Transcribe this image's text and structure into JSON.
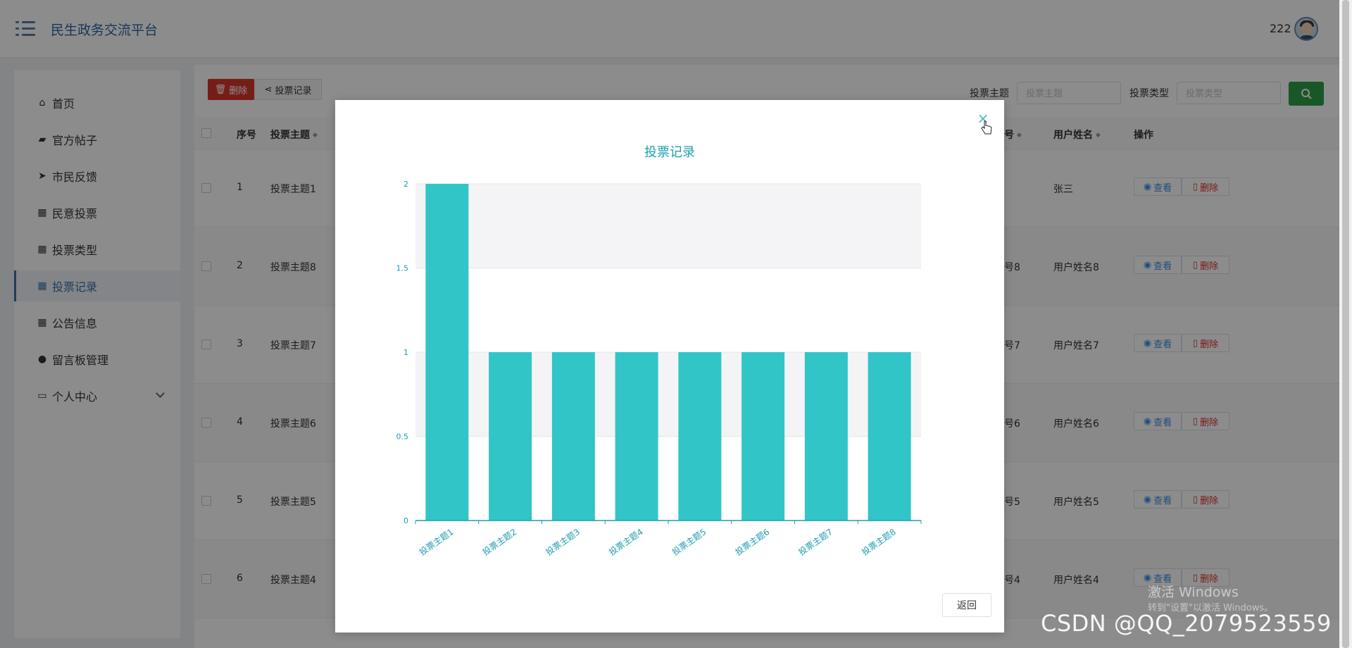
{
  "header": {
    "brand": "民生政务交流平台",
    "username": "222"
  },
  "sidebar": {
    "items": [
      {
        "label": "首页",
        "icon": "home-icon",
        "glyph": "⌂"
      },
      {
        "label": "官方帖子",
        "icon": "wallet-icon",
        "glyph": "▰"
      },
      {
        "label": "市民反馈",
        "icon": "paper-plane-icon",
        "glyph": "➤"
      },
      {
        "label": "民意投票",
        "icon": "grid-icon",
        "glyph": "▦"
      },
      {
        "label": "投票类型",
        "icon": "apps-icon",
        "glyph": "▦"
      },
      {
        "label": "投票记录",
        "icon": "grid-icon",
        "glyph": "▦"
      },
      {
        "label": "公告信息",
        "icon": "grid-icon",
        "glyph": "▦"
      },
      {
        "label": "留言板管理",
        "icon": "user-icon",
        "glyph": "●"
      },
      {
        "label": "个人中心",
        "icon": "id-card-icon",
        "glyph": "▭"
      }
    ]
  },
  "toolbar": {
    "delete_label": "删除",
    "record_label": "投票记录",
    "topic_label": "投票主题",
    "topic_placeholder": "投票主题",
    "type_label": "投票类型",
    "type_placeholder": "投票类型"
  },
  "table": {
    "headers": {
      "index": "序号",
      "topic": "投票主题",
      "account_tail": "号",
      "username": "用户姓名",
      "action": "操作"
    },
    "rows": [
      {
        "index": "1",
        "topic": "投票主题1",
        "account_tail": "",
        "username": "张三"
      },
      {
        "index": "2",
        "topic": "投票主题8",
        "account_tail": "号8",
        "username": "用户姓名8"
      },
      {
        "index": "3",
        "topic": "投票主题7",
        "account_tail": "号7",
        "username": "用户姓名7"
      },
      {
        "index": "4",
        "topic": "投票主题6",
        "account_tail": "号6",
        "username": "用户姓名6"
      },
      {
        "index": "5",
        "topic": "投票主题5",
        "account_tail": "号5",
        "username": "用户姓名5"
      },
      {
        "index": "6",
        "topic": "投票主题4",
        "account_tail": "号4",
        "username": "用户姓名4"
      }
    ],
    "view_label": "查看",
    "delete_label": "删除"
  },
  "modal": {
    "return_label": "返回",
    "close_glyph": "×"
  },
  "chart_data": {
    "type": "bar",
    "title": "投票记录",
    "categories": [
      "投票主题1",
      "投票主题2",
      "投票主题3",
      "投票主题4",
      "投票主题5",
      "投票主题6",
      "投票主题7",
      "投票主题8"
    ],
    "values": [
      2,
      1,
      1,
      1,
      1,
      1,
      1,
      1
    ],
    "yticks": [
      "0",
      "0.5",
      "1",
      "1.5",
      "2"
    ],
    "ylim": [
      0,
      2
    ],
    "xlabel": "",
    "ylabel": "",
    "grid": true,
    "bar_color": "#32c5c8",
    "axis_color": "#1e9eae"
  },
  "watermarks": {
    "windows_title": "激活 Windows",
    "windows_sub": "转到\"设置\"以激活 Windows。",
    "csdn": "CSDN @QQ_2079523559"
  },
  "colors": {
    "primary": "#3a6fa8",
    "danger": "#d9352b",
    "success": "#2f9e47",
    "chart": "#32c5c8"
  }
}
